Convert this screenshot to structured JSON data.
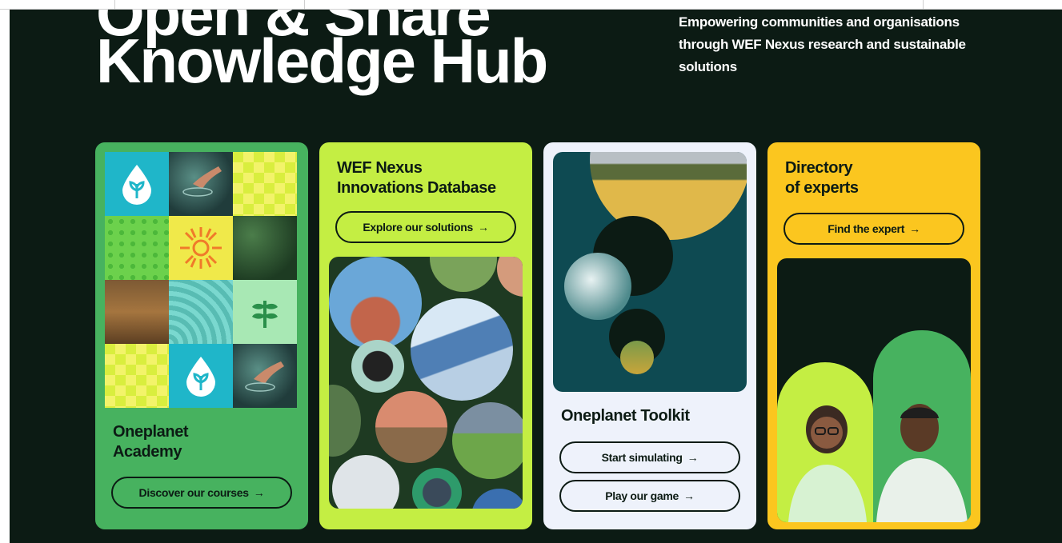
{
  "hero": {
    "clipped_title": "Open & Share",
    "title": "Knowledge Hub",
    "tagline": "Empowering communities and organisations through WEF Nexus research and sustainable solutions"
  },
  "cards": {
    "academy": {
      "title_line1": "Oneplanet",
      "title_line2": "Academy",
      "button": "Discover our courses"
    },
    "database": {
      "title_line1": "WEF Nexus",
      "title_line2": "Innovations Database",
      "button": "Explore our solutions"
    },
    "toolkit": {
      "title": "Oneplanet Toolkit",
      "button1": "Start simulating",
      "button2": "Play our game"
    },
    "experts": {
      "title_line1": "Directory",
      "title_line2": "of experts",
      "button": "Find the expert"
    }
  },
  "arrow": "→",
  "colors": {
    "background": "#0c1b14",
    "academy": "#47b25f",
    "database": "#c4ee43",
    "toolkit": "#eef2fb",
    "experts": "#fbc61f"
  }
}
